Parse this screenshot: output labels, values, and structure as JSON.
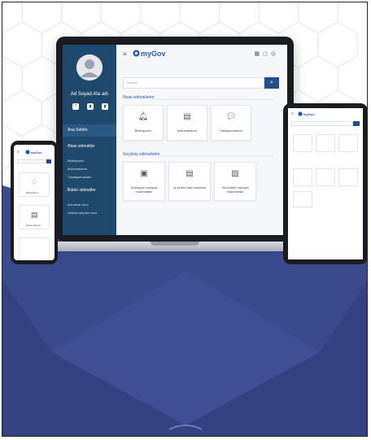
{
  "laptop": {
    "user_name": "Ad Soyad Ata adı",
    "logo": "myGov",
    "search_placeholder": "Axtarış",
    "sidebar": {
      "home": "Ana Səhifə",
      "my_services": "Əsas xidmətlər",
      "my_services_items": [
        "Bildirişlərim",
        "Məlumatlarım",
        "Təsdiqləmələrim"
      ],
      "all_services": "Bütün xidmətlər",
      "all_services_items": [
        "Qurumlar üzrə",
        "Xidmət qrupları üzrə"
      ]
    },
    "sections": {
      "main": "Əsas xidmətlərim",
      "chosen": "Seçilmiş xidmətlərim"
    },
    "main_cards": [
      "Bildirişlərim",
      "Məlumatlarım",
      "Təsdiqləmələrim"
    ],
    "chosen_cards": [
      "Şəxsiyyət vəsiqəsi məlumatları",
      "İş yerinə dair məlumat",
      "Sürücülük vəsiqəsi məlumatları"
    ]
  },
  "phone": {
    "logo": "myGov",
    "cards": [
      "Bildirişlərim",
      "Məlumatlarım"
    ]
  },
  "tablet": {
    "logo": "myGov"
  },
  "colors": {
    "sidebar": "#1f4a6e",
    "accent": "#254d8f",
    "band": "#3b4a8c",
    "band_dark": "#2e3a78"
  }
}
